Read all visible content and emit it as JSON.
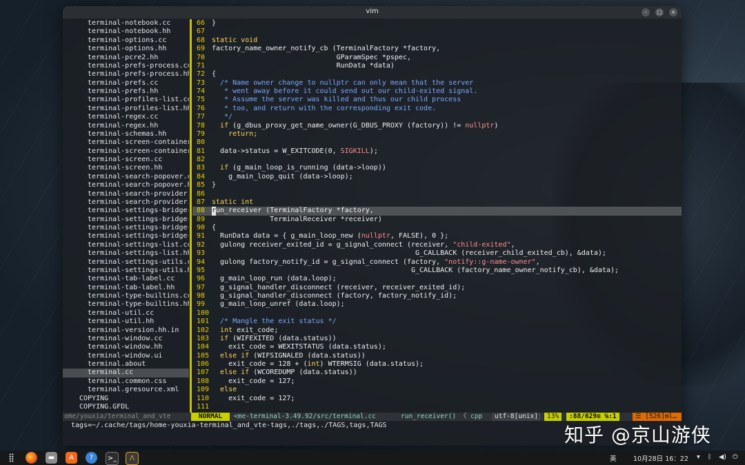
{
  "window": {
    "title": "vim"
  },
  "file_tree": [
    {
      "name": "terminal-notebook.cc"
    },
    {
      "name": "terminal-notebook.hh"
    },
    {
      "name": "terminal-options.cc"
    },
    {
      "name": "terminal-options.hh"
    },
    {
      "name": "terminal-pcre2.hh"
    },
    {
      "name": "terminal-prefs-process.cc"
    },
    {
      "name": "terminal-prefs-process.hh"
    },
    {
      "name": "terminal-prefs.cc"
    },
    {
      "name": "terminal-prefs.hh"
    },
    {
      "name": "terminal-profiles-list.cc"
    },
    {
      "name": "terminal-profiles-list.hh"
    },
    {
      "name": "terminal-regex.cc"
    },
    {
      "name": "terminal-regex.hh"
    },
    {
      "name": "terminal-schemas.hh"
    },
    {
      "name": "terminal-screen-container"
    },
    {
      "name": "terminal-screen-container"
    },
    {
      "name": "terminal-screen.cc"
    },
    {
      "name": "terminal-screen.hh"
    },
    {
      "name": "terminal-search-popover.c"
    },
    {
      "name": "terminal-search-popover.h"
    },
    {
      "name": "terminal-search-provider."
    },
    {
      "name": "terminal-search-provider."
    },
    {
      "name": "terminal-settings-bridge-"
    },
    {
      "name": "terminal-settings-bridge-"
    },
    {
      "name": "terminal-settings-bridge-"
    },
    {
      "name": "terminal-settings-bridge-"
    },
    {
      "name": "terminal-settings-list.cc"
    },
    {
      "name": "terminal-settings-list.hh"
    },
    {
      "name": "terminal-settings-utils.c"
    },
    {
      "name": "terminal-settings-utils.h"
    },
    {
      "name": "terminal-tab-label.cc"
    },
    {
      "name": "terminal-tab-label.hh"
    },
    {
      "name": "terminal-type-builtins.cc"
    },
    {
      "name": "terminal-type-builtins.hh"
    },
    {
      "name": "terminal-util.cc"
    },
    {
      "name": "terminal-util.hh"
    },
    {
      "name": "terminal-version.hh.in"
    },
    {
      "name": "terminal-window.cc"
    },
    {
      "name": "terminal-window.hh"
    },
    {
      "name": "terminal-window.ui"
    },
    {
      "name": "terminal.about"
    },
    {
      "name": "terminal.cc",
      "selected": true
    },
    {
      "name": "terminal.common.css"
    },
    {
      "name": "terminal.gresource.xml"
    },
    {
      "name": "COPYING",
      "dir": true
    },
    {
      "name": "COPYING.GFDL",
      "dir": true
    }
  ],
  "code_lines": [
    {
      "n": "66",
      "cur": false,
      "t": [
        [
          "}",
          ""
        ]
      ]
    },
    {
      "n": "67",
      "cur": false,
      "t": []
    },
    {
      "n": "68",
      "cur": false,
      "t": [
        [
          "static void",
          "k"
        ]
      ]
    },
    {
      "n": "69",
      "cur": false,
      "t": [
        [
          "factory_name_owner_notify_cb (TerminalFactory *factory,",
          ""
        ]
      ]
    },
    {
      "n": "70",
      "cur": false,
      "t": [
        [
          "                              GParamSpec *pspec,",
          ""
        ]
      ]
    },
    {
      "n": "71",
      "cur": false,
      "t": [
        [
          "                              RunData *data)",
          ""
        ]
      ]
    },
    {
      "n": "72",
      "cur": false,
      "t": [
        [
          "{",
          ""
        ]
      ]
    },
    {
      "n": "73",
      "cur": false,
      "t": [
        [
          "  /* Name owner change to nullptr can only mean that the server",
          "c"
        ]
      ]
    },
    {
      "n": "74",
      "cur": false,
      "t": [
        [
          "   * went away before it could send out our child-exited signal.",
          "c"
        ]
      ]
    },
    {
      "n": "75",
      "cur": false,
      "t": [
        [
          "   * Assume the server was killed and thus our child process",
          "c"
        ]
      ]
    },
    {
      "n": "76",
      "cur": false,
      "t": [
        [
          "   * too, and return with the corresponding exit code.",
          "c"
        ]
      ]
    },
    {
      "n": "77",
      "cur": false,
      "t": [
        [
          "   */",
          "c"
        ]
      ]
    },
    {
      "n": "78",
      "cur": false,
      "t": [
        [
          "  ",
          ""
        ],
        [
          "if",
          "k"
        ],
        [
          " (g_dbus_proxy_get_name_owner(G_DBUS_PROXY (factory)) != ",
          ""
        ],
        [
          "nullptr",
          "n"
        ],
        [
          ")",
          ""
        ]
      ]
    },
    {
      "n": "79",
      "cur": false,
      "t": [
        [
          "    ",
          ""
        ],
        [
          "return;",
          "k"
        ]
      ]
    },
    {
      "n": "80",
      "cur": false,
      "t": []
    },
    {
      "n": "81",
      "cur": false,
      "t": [
        [
          "  data->status = W_EXITCODE(0, ",
          ""
        ],
        [
          "SIGKILL",
          "s"
        ],
        [
          ");",
          ""
        ]
      ]
    },
    {
      "n": "82",
      "cur": false,
      "t": []
    },
    {
      "n": "83",
      "cur": false,
      "t": [
        [
          "  ",
          ""
        ],
        [
          "if",
          "k"
        ],
        [
          " (g_main_loop_is_running (data->loop))",
          ""
        ]
      ]
    },
    {
      "n": "84",
      "cur": false,
      "t": [
        [
          "    g_main_loop_quit (data->loop);",
          ""
        ]
      ]
    },
    {
      "n": "85",
      "cur": false,
      "t": [
        [
          "}",
          ""
        ]
      ]
    },
    {
      "n": "86",
      "cur": false,
      "t": []
    },
    {
      "n": "87",
      "cur": false,
      "t": [
        [
          "static int",
          "k"
        ]
      ]
    },
    {
      "n": "88",
      "cur": true,
      "t": [
        [
          "r",
          "cursor"
        ],
        [
          "un_receiver (TerminalFactory *factory,",
          ""
        ]
      ]
    },
    {
      "n": "89",
      "cur": false,
      "t": [
        [
          "              TerminalReceiver *receiver)",
          ""
        ]
      ]
    },
    {
      "n": "90",
      "cur": false,
      "t": [
        [
          "{",
          ""
        ]
      ]
    },
    {
      "n": "91",
      "cur": false,
      "t": [
        [
          "  RunData data = { g_main_loop_new (",
          ""
        ],
        [
          "nullptr",
          "n"
        ],
        [
          ", FALSE), 0 };",
          ""
        ]
      ]
    },
    {
      "n": "92",
      "cur": false,
      "t": [
        [
          "  gulong receiver_exited_id = g_signal_connect (receiver, ",
          ""
        ],
        [
          "\"child-exited\"",
          "s"
        ],
        [
          ",",
          ""
        ]
      ]
    },
    {
      "n": "93",
      "cur": false,
      "t": [
        [
          "                                                 G_CALLBACK (receiver_child_exited_cb), &data);",
          ""
        ]
      ]
    },
    {
      "n": "94",
      "cur": false,
      "t": [
        [
          "  gulong factory_notify_id = g_signal_connect (factory, ",
          ""
        ],
        [
          "\"notify::g-name-owner\"",
          "s"
        ],
        [
          ",",
          ""
        ]
      ]
    },
    {
      "n": "95",
      "cur": false,
      "t": [
        [
          "                                                G_CALLBACK (factory_name_owner_notify_cb), &data);",
          ""
        ]
      ]
    },
    {
      "n": "96",
      "cur": false,
      "t": [
        [
          "  g_main_loop_run (data.loop);",
          ""
        ]
      ]
    },
    {
      "n": "97",
      "cur": false,
      "t": [
        [
          "  g_signal_handler_disconnect (receiver, receiver_exited_id);",
          ""
        ]
      ]
    },
    {
      "n": "98",
      "cur": false,
      "t": [
        [
          "  g_signal_handler_disconnect (factory, factory_notify_id);",
          ""
        ]
      ]
    },
    {
      "n": "99",
      "cur": false,
      "t": [
        [
          "  g_main_loop_unref (data.loop);",
          ""
        ]
      ]
    },
    {
      "n": "100",
      "cur": false,
      "t": []
    },
    {
      "n": "101",
      "cur": false,
      "t": [
        [
          "  /* Mangle the exit status */",
          "c"
        ]
      ]
    },
    {
      "n": "102",
      "cur": false,
      "t": [
        [
          "  ",
          ""
        ],
        [
          "int",
          "k"
        ],
        [
          " exit_code;",
          ""
        ]
      ]
    },
    {
      "n": "103",
      "cur": false,
      "t": [
        [
          "  ",
          ""
        ],
        [
          "if",
          "k"
        ],
        [
          " (WIFEXITED (data.status))",
          ""
        ]
      ]
    },
    {
      "n": "104",
      "cur": false,
      "t": [
        [
          "    exit_code = WEXITSTATUS (data.status);",
          ""
        ]
      ]
    },
    {
      "n": "105",
      "cur": false,
      "t": [
        [
          "  ",
          ""
        ],
        [
          "else if",
          "k"
        ],
        [
          " (WIFSIGNALED (data.status))",
          ""
        ]
      ]
    },
    {
      "n": "106",
      "cur": false,
      "t": [
        [
          "    exit_code = 128 + (",
          ""
        ],
        [
          "int",
          "k"
        ],
        [
          ") WTERMSIG (data.status);",
          ""
        ]
      ]
    },
    {
      "n": "107",
      "cur": false,
      "t": [
        [
          "  ",
          ""
        ],
        [
          "else if",
          "k"
        ],
        [
          " (WCOREDUMP (data.status))",
          ""
        ]
      ]
    },
    {
      "n": "108",
      "cur": false,
      "t": [
        [
          "    exit_code = 127;",
          ""
        ]
      ]
    },
    {
      "n": "109",
      "cur": false,
      "t": [
        [
          "  ",
          ""
        ],
        [
          "else",
          "k"
        ]
      ]
    },
    {
      "n": "110",
      "cur": false,
      "t": [
        [
          "    exit_code = 127;",
          ""
        ]
      ]
    },
    {
      "n": "111",
      "cur": false,
      "t": []
    }
  ],
  "statusbar": {
    "tree_path": "ome/youxia/terminal_and_vte",
    "mode": "NORMAL",
    "file": "<me-terminal-3.49.92/src/terminal.cc",
    "function": "run_receiver() 〈 cpp",
    "encoding": "utf-8[unix]",
    "percent": "13%",
    "position": ":88/629≡ ℅:1",
    "warning": "☰ [526]ml…"
  },
  "cmdline": "tags=~/.cache/tags/home-youxia-terminal_and_vte-tags,./tags,./TAGS,tags,TAGS",
  "watermark": "知乎 @京山游侠",
  "taskbar": {
    "ime": "英",
    "datetime": "10月28日 16：22"
  },
  "colors": {
    "line_number": "#e5d000",
    "keyword": "#ffd75f",
    "string": "#ff8f8f",
    "comment": "#7aa7ff",
    "mode_bg": "#c8d000",
    "warning_bg": "#e06c00"
  }
}
